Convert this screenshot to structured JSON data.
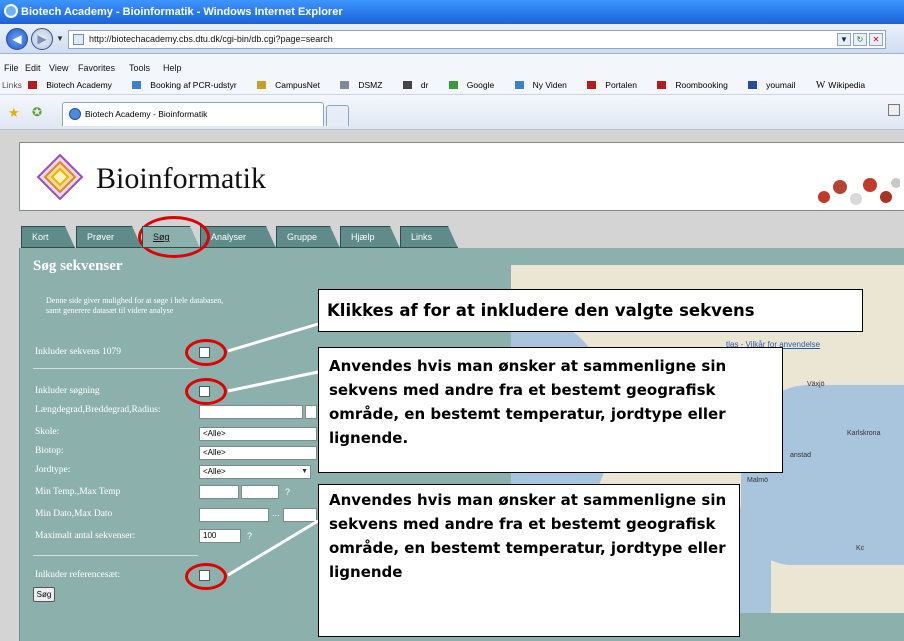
{
  "window": {
    "title": "Biotech Academy - Bioinformatik - Windows Internet Explorer"
  },
  "address": {
    "url": "http://biotechacademy.cbs.dtu.dk/cgi-bin/db.cgi?page=search"
  },
  "menu": [
    "File",
    "Edit",
    "View",
    "Favorites",
    "Tools",
    "Help"
  ],
  "links_bar": {
    "label": "Links",
    "items": [
      "Biotech Academy",
      "Booking af PCR-udstyr",
      "CampusNet",
      "DSMZ",
      "dr",
      "Google",
      "Ny Viden",
      "Portalen",
      "Roombooking",
      "youmail",
      "Wikipedia"
    ]
  },
  "browser_tab": {
    "label": "Biotech Academy - Bioinformatik"
  },
  "site": {
    "title": "Bioinformatik",
    "tabs": [
      "Kort",
      "Prøver",
      "Søg",
      "Analyser",
      "Gruppe",
      "Hjælp",
      "Links"
    ],
    "active_tab": "Søg"
  },
  "search": {
    "heading": "Søg sekvenser",
    "intro_line1": "Denne side giver mulighed for at søge i hele databasen,",
    "intro_line2": "samt generere datasæt til videre analyse",
    "include_sequence_label": "Inkluder sekvens 1079",
    "include_search_label": "Inkluder søgning",
    "coords_label": "Længdegrad,Breddegrad,Radius:",
    "school_label": "Skole:",
    "school_value": "<Alle>",
    "biotope_label": "Biotop:",
    "biotope_value": "<Alle>",
    "soil_label": "Jordtype:",
    "soil_value": "<Alle>",
    "temp_label": "Min Temp.,Max Temp",
    "date_label": "Min Dato,Max Dato",
    "max_label": "Maximalt antal sekvenser:",
    "max_value": "100",
    "help_mark": "?",
    "date_dots": "...",
    "ref_label": "Inlkuder referencesæt:",
    "search_button": "Søg"
  },
  "map": {
    "labels": [
      "Växjö",
      "Karlskrona",
      "Malmö",
      "Kc",
      "anstad"
    ],
    "terms": "tlas - Vilkår for anvendelse"
  },
  "annotations": {
    "callout1": "Klikkes af for at inkludere den valgte sekvens",
    "callout2": "Anvendes hvis man ønsker at sammenligne sin sekvens med andre fra et bestemt geografisk område, en bestemt temperatur, jordtype eller lignende.",
    "callout3": "Anvendes hvis man ønsker at sammenligne sin sekvens med andre fra et bestemt geografisk område, en bestemt temperatur, jordtype eller lignende"
  },
  "icons": [
    "back-icon",
    "forward-icon",
    "star-icon",
    "add-favorite-icon",
    "home-icon",
    "refresh-icon",
    "close-icon"
  ],
  "colors": {
    "content_bg": "#8cb1ad",
    "tab_bg": "#5f8c8a",
    "highlight_red": "#e00000"
  }
}
